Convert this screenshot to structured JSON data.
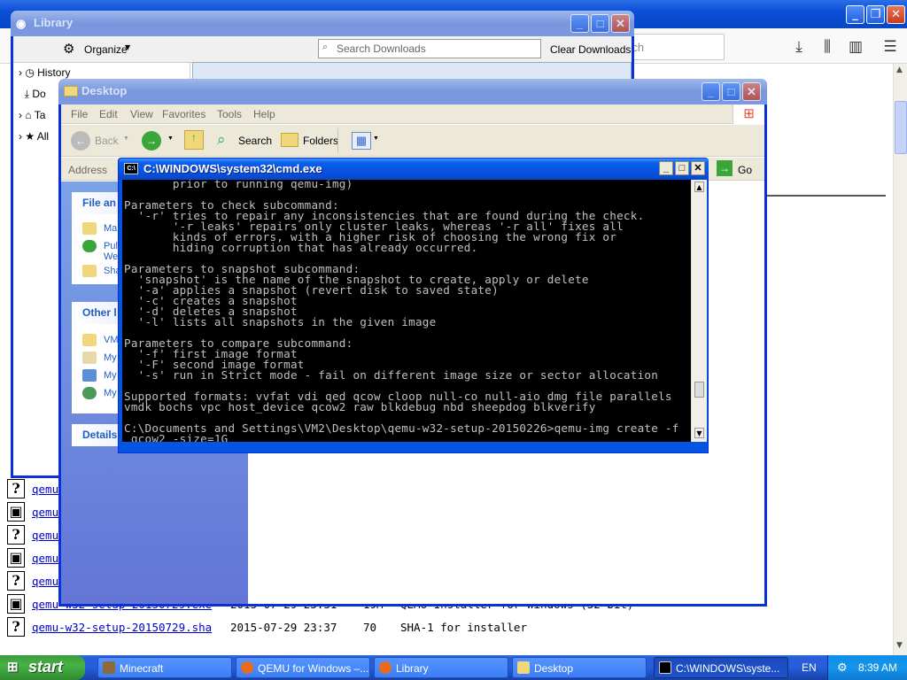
{
  "browser": {
    "search_placeholder": "rch",
    "rows": [
      {
        "icon": "?",
        "name": "qemu",
        "date": "",
        "size": "",
        "desc": ""
      },
      {
        "icon": "▣",
        "name": "qemu",
        "date": "",
        "size": "",
        "desc": ""
      },
      {
        "icon": "?",
        "name": "qemu",
        "date": "",
        "size": "",
        "desc": ""
      },
      {
        "icon": "▣",
        "name": "qemu",
        "date": "",
        "size": "",
        "desc": ""
      },
      {
        "icon": "?",
        "name": "qemu",
        "date": "",
        "size": "",
        "desc": ""
      },
      {
        "icon": "▣",
        "name": "qemu-w32-setup-20150729.exe",
        "date": "2015-07-29 23:31",
        "size": "19M",
        "desc": "QEMU Installer for Windows (32 bit)"
      },
      {
        "icon": "?",
        "name": "qemu-w32-setup-20150729.sha",
        "date": "2015-07-29 23:37",
        "size": "70",
        "desc": "SHA-1 for installer"
      }
    ]
  },
  "library": {
    "title": "Library",
    "organize": "Organize",
    "search_placeholder": "Search Downloads",
    "clear_downloads": "Clear Downloads",
    "tree": [
      "History",
      "Do",
      "Ta",
      "All"
    ]
  },
  "explorer": {
    "title": "Desktop",
    "menu": [
      "File",
      "Edit",
      "View",
      "Favorites",
      "Tools",
      "Help"
    ],
    "back": "Back",
    "search": "Search",
    "folders": "Folders",
    "address_label": "Address",
    "go": "Go",
    "file_tasks_head": "File an",
    "file_tasks": [
      "Ma",
      "Pul",
      "We",
      "Sha"
    ],
    "other_places_head": "Other l",
    "other_places": [
      "VM",
      "My",
      "My",
      "My"
    ],
    "details_head": "Details"
  },
  "cmd": {
    "title": "C:\\WINDOWS\\system32\\cmd.exe",
    "lines": [
      "       prior to running qemu-img)",
      "",
      "Parameters to check subcommand:",
      "  '-r' tries to repair any inconsistencies that are found during the check.",
      "       '-r leaks' repairs only cluster leaks, whereas '-r all' fixes all",
      "       kinds of errors, with a higher risk of choosing the wrong fix or",
      "       hiding corruption that has already occurred.",
      "",
      "Parameters to snapshot subcommand:",
      "  'snapshot' is the name of the snapshot to create, apply or delete",
      "  '-a' applies a snapshot (revert disk to saved state)",
      "  '-c' creates a snapshot",
      "  '-d' deletes a snapshot",
      "  '-l' lists all snapshots in the given image",
      "",
      "Parameters to compare subcommand:",
      "  '-f' first image format",
      "  '-F' second image format",
      "  '-s' run in Strict mode - fail on different image size or sector allocation",
      "",
      "Supported formats: vvfat vdi qed qcow cloop null-co null-aio dmg file parallels",
      "vmdk bochs vpc host_device qcow2 raw blkdebug nbd sheepdog blkverify",
      "",
      "C:\\Documents and Settings\\VM2\\Desktop\\qemu-w32-setup-20150226>qemu-img create -f",
      " qcow2 -size=1G"
    ]
  },
  "taskbar": {
    "start": "start",
    "tasks": [
      "Minecraft",
      "QEMU for Windows –...",
      "Library",
      "Desktop",
      "C:\\WINDOWS\\syste..."
    ],
    "lang": "EN",
    "clock": "8:39 AM"
  },
  "colors": {
    "xp_blue": "#0554e3",
    "start_green": "#3c9a3c",
    "tray_blue": "#1595eb"
  }
}
